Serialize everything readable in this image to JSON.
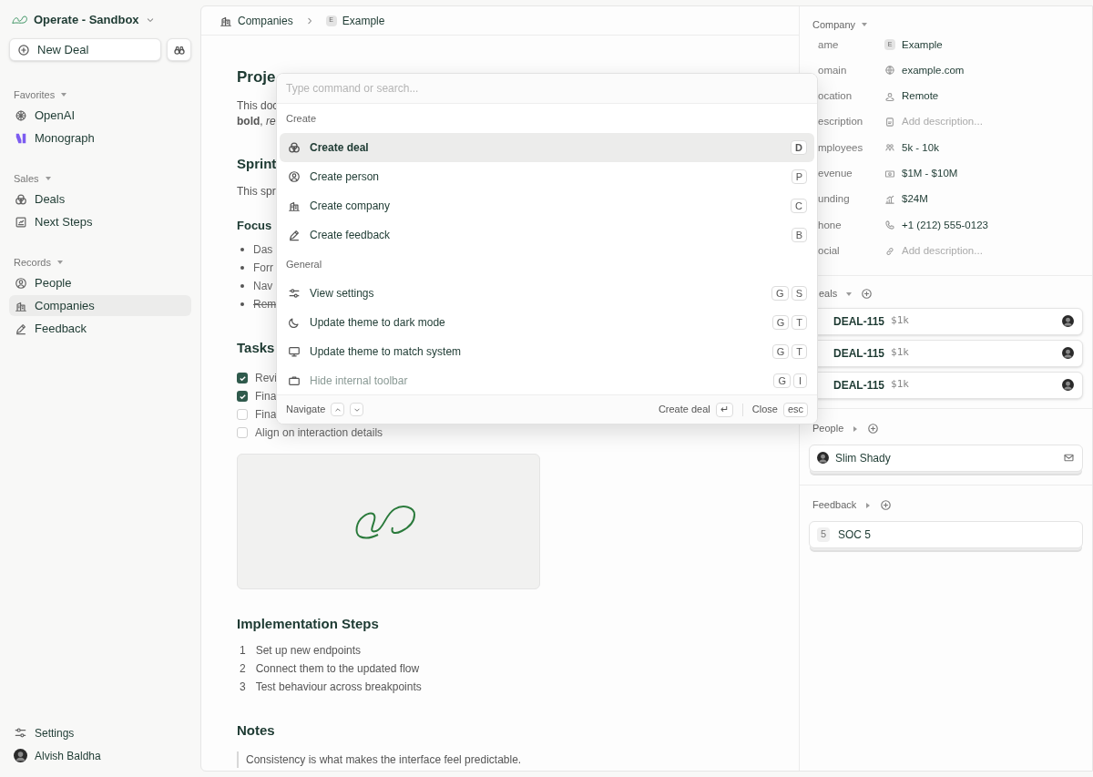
{
  "workspace": {
    "name": "Operate - Sandbox"
  },
  "new_deal_button": {
    "label": "New Deal"
  },
  "sidebar": {
    "sections": [
      {
        "title": "Favorites",
        "items": [
          {
            "label": "OpenAI",
            "selected": false
          },
          {
            "label": "Monograph",
            "selected": false
          }
        ]
      },
      {
        "title": "Sales",
        "items": [
          {
            "label": "Deals",
            "selected": false
          },
          {
            "label": "Next Steps",
            "selected": false
          }
        ]
      },
      {
        "title": "Records",
        "items": [
          {
            "label": "People",
            "selected": false
          },
          {
            "label": "Companies",
            "selected": true
          },
          {
            "label": "Feedback",
            "selected": false
          }
        ]
      }
    ],
    "footer": [
      {
        "label": "Settings"
      },
      {
        "label": "Alvish Baldha"
      }
    ]
  },
  "breadcrumb": [
    {
      "label": "Companies"
    },
    {
      "label": "Example",
      "badge": "E"
    }
  ],
  "document": {
    "title": "Proje",
    "blocks": [
      {
        "kind": "paragraph",
        "lines": [
          "This doc",
          "**bold**, *re*"
        ]
      },
      {
        "kind": "heading",
        "text": "Sprint"
      },
      {
        "kind": "paragraph",
        "lines": [
          "This spr"
        ]
      },
      {
        "kind": "subheading",
        "text": "Focus"
      },
      {
        "kind": "bullets",
        "items": [
          {
            "text": "Das",
            "struck": false
          },
          {
            "text": "Forr",
            "struck": false
          },
          {
            "text": "Nav",
            "struck": false
          },
          {
            "text": "Rem",
            "struck": true
          }
        ]
      },
      {
        "kind": "heading",
        "text": "Tasks"
      },
      {
        "kind": "tasks",
        "items": [
          {
            "text": "Revi",
            "checked": true
          },
          {
            "text": "Fina",
            "checked": true
          },
          {
            "text": "Fina",
            "checked": false
          },
          {
            "text": "Align on interaction details",
            "checked": false
          }
        ]
      },
      {
        "kind": "image"
      },
      {
        "kind": "heading",
        "text": "Implementation Steps"
      },
      {
        "kind": "numbered",
        "items": [
          {
            "number": "1",
            "text": "Set up new endpoints"
          },
          {
            "number": "2",
            "text": "Connect them to the updated flow"
          },
          {
            "number": "3",
            "text": "Test behaviour across breakpoints"
          }
        ]
      },
      {
        "kind": "heading",
        "text": "Notes"
      },
      {
        "kind": "quote",
        "text": "Consistency is what makes the interface feel predictable."
      }
    ]
  },
  "details": {
    "title": "Company",
    "expanded": true,
    "fields": [
      {
        "label": "ame",
        "badge": "E",
        "value": "Example"
      },
      {
        "label": "omain",
        "value": "example.com"
      },
      {
        "label": "ocation",
        "value": "Remote"
      },
      {
        "label": "escription",
        "placeholder": "Add description..."
      },
      {
        "label": "mployees",
        "value": "5k - 10k"
      },
      {
        "label": "evenue",
        "value": "$1M - $10M"
      },
      {
        "label": "unding",
        "value": "$24M"
      },
      {
        "label": "hone",
        "value": "+1 (212) 555-0123"
      },
      {
        "label": "ocial",
        "placeholder": "Add description..."
      }
    ]
  },
  "deals": {
    "title": "eals",
    "expanded": true,
    "items": [
      {
        "id": "DEAL-115",
        "amount": "$1k"
      },
      {
        "id": "DEAL-115",
        "amount": "$1k"
      },
      {
        "id": "DEAL-115",
        "amount": "$1k"
      }
    ]
  },
  "people": {
    "title": "People",
    "expanded": false,
    "items": [
      {
        "name": "Slim Shady"
      }
    ]
  },
  "feedback": {
    "title": "Feedback",
    "expanded": false,
    "items": [
      {
        "number": "5",
        "title": "SOC 5"
      }
    ]
  },
  "palette": {
    "placeholder": "Type command or search...",
    "groups": [
      {
        "heading": "Create",
        "items": [
          {
            "label": "Create deal",
            "keys": [
              "D"
            ],
            "selected": true
          },
          {
            "label": "Create person",
            "keys": [
              "P"
            ],
            "selected": false
          },
          {
            "label": "Create company",
            "keys": [
              "C"
            ],
            "selected": false
          },
          {
            "label": "Create feedback",
            "keys": [
              "B"
            ],
            "selected": false
          }
        ]
      },
      {
        "heading": "General",
        "items": [
          {
            "label": "View settings",
            "keys": [
              "G",
              "S"
            ],
            "selected": false
          },
          {
            "label": "Update theme to dark mode",
            "keys": [
              "G",
              "T"
            ],
            "selected": false
          },
          {
            "label": "Update theme to match system",
            "keys": [
              "G",
              "T"
            ],
            "selected": false
          },
          {
            "label": "Hide internal toolbar",
            "keys": [
              "G",
              "I"
            ],
            "selected": false
          }
        ]
      }
    ],
    "footer": {
      "navigate": "Navigate",
      "action": "Create deal",
      "action_key": "↵",
      "close": "Close",
      "close_key": "esc"
    }
  }
}
